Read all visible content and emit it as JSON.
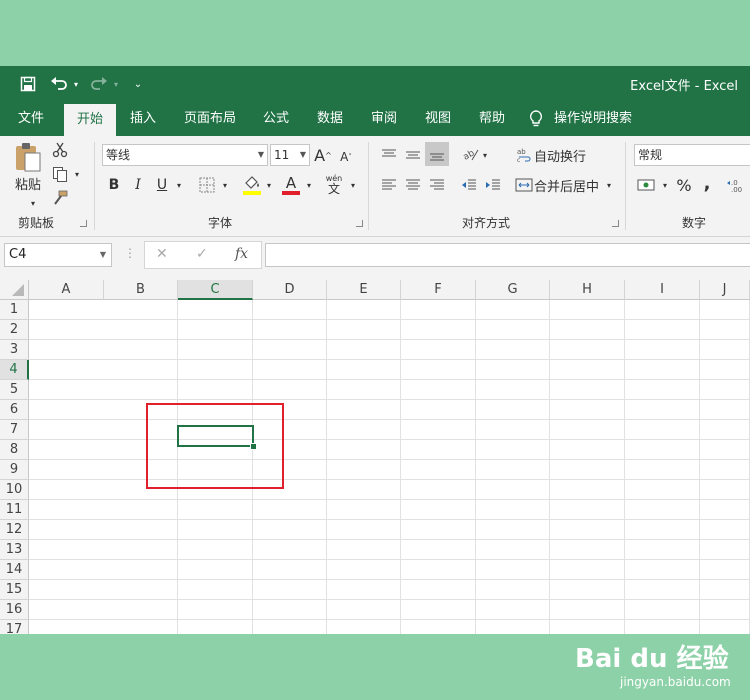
{
  "window": {
    "title": "Excel文件  -  Excel"
  },
  "qat": {
    "save_icon": "save-icon",
    "undo_icon": "undo-icon",
    "redo_icon": "redo-icon",
    "customize_icon": "customize-qat-icon"
  },
  "tabs": [
    {
      "label": "文件"
    },
    {
      "label": "开始"
    },
    {
      "label": "插入"
    },
    {
      "label": "页面布局"
    },
    {
      "label": "公式"
    },
    {
      "label": "数据"
    },
    {
      "label": "审阅"
    },
    {
      "label": "视图"
    },
    {
      "label": "帮助"
    },
    {
      "label": "操作说明搜索"
    }
  ],
  "active_tab": "开始",
  "ribbon": {
    "clipboard": {
      "label": "剪贴板",
      "paste_label": "粘贴"
    },
    "font": {
      "label": "字体",
      "font_name": "等线",
      "font_size": "11",
      "bold": "B",
      "italic": "I",
      "underline": "U",
      "grow_font": "A",
      "shrink_font": "A",
      "font_color_letter": "A",
      "wen_top": "wén",
      "wen_bottom": "文",
      "fill_color": "#ffff00",
      "font_color": "#e0202a"
    },
    "alignment": {
      "label": "对齐方式",
      "wrap_text": "自动换行",
      "merge_center": "合并后居中"
    },
    "number": {
      "label": "数字",
      "format": "常规",
      "percent": "%",
      "comma": ","
    }
  },
  "formula_bar": {
    "name_box": "C4",
    "cancel": "✕",
    "enter": "✓",
    "fx": "fx",
    "value": ""
  },
  "sheet": {
    "columns": [
      "A",
      "B",
      "C",
      "D",
      "E",
      "F",
      "G",
      "H",
      "I",
      "J"
    ],
    "rows": [
      "1",
      "2",
      "3",
      "4",
      "5",
      "6",
      "7",
      "8",
      "9",
      "10",
      "11",
      "12",
      "13",
      "14",
      "15",
      "16",
      "17"
    ],
    "active_cell": "C4",
    "accent_color": "#217346",
    "highlight_color": "#e0202a"
  },
  "watermark": {
    "logo": "Bai du 经验",
    "url": "jingyan.baidu.com"
  }
}
